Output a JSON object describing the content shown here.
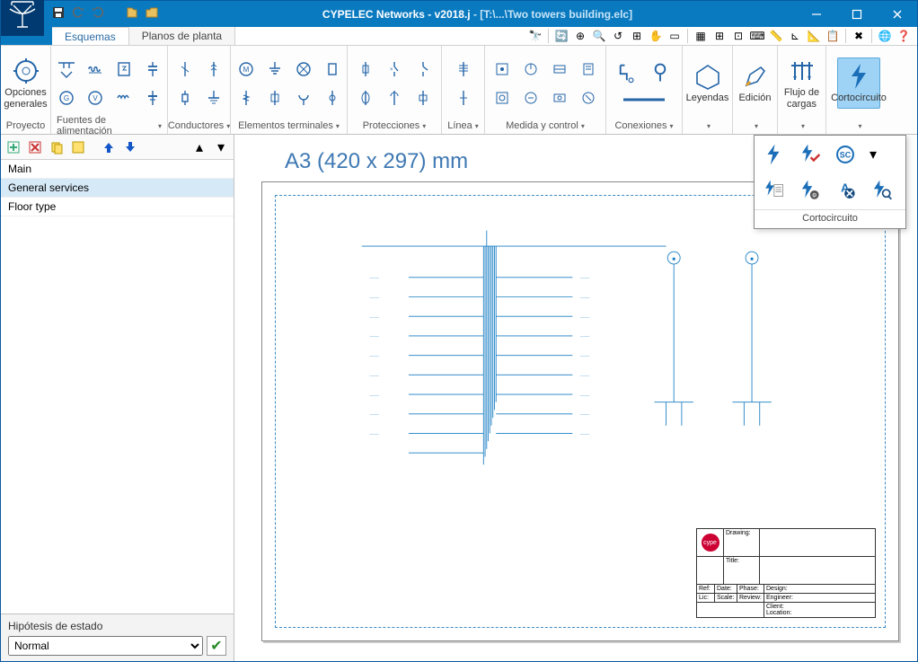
{
  "window": {
    "title_app": "CYPELEC Networks - v2018.j",
    "title_path": " - [T:\\...\\Two towers building.elc]",
    "minimize": "—",
    "maximize": "☐",
    "close": "✕"
  },
  "tabs": {
    "esquemas": "Esquemas",
    "planos": "Planos de planta"
  },
  "ribbon": {
    "proyecto": {
      "label": "Proyecto",
      "big": "Opciones\ngenerales"
    },
    "fuentes": {
      "label": "Fuentes de alimentación"
    },
    "conductores": {
      "label": "Conductores"
    },
    "elementos": {
      "label": "Elementos terminales"
    },
    "protecciones": {
      "label": "Protecciones"
    },
    "linea": {
      "label": "Línea"
    },
    "medida": {
      "label": "Medida y control"
    },
    "conexiones": {
      "label": "Conexiones"
    },
    "leyendas": {
      "label": "Leyendas"
    },
    "edicion": {
      "label": "Edición"
    },
    "flujo": {
      "label": "Flujo de\ncargas"
    },
    "corto": {
      "label": "Cortocircuito"
    }
  },
  "sc_panel": {
    "label": "Cortocircuito"
  },
  "sidebar": {
    "items": [
      "Main",
      "General services",
      "Floor type"
    ],
    "selected_index": 1
  },
  "hypothesis": {
    "label": "Hipótesis de estado",
    "options": [
      "Normal"
    ],
    "value": "Normal"
  },
  "canvas": {
    "paper_title": "A3 (420 x 297) mm"
  },
  "title_block": {
    "drawing": "Drawing:",
    "title": "Title:",
    "ref": "Ref:",
    "date": "Date:",
    "phase": "Phase:",
    "design": "Design:",
    "lic": "Lic:",
    "scale": "Scale:",
    "review": "Review:",
    "engineer": "Engineer:",
    "client": "Client:",
    "location": "Location:",
    "logo": "cype"
  }
}
